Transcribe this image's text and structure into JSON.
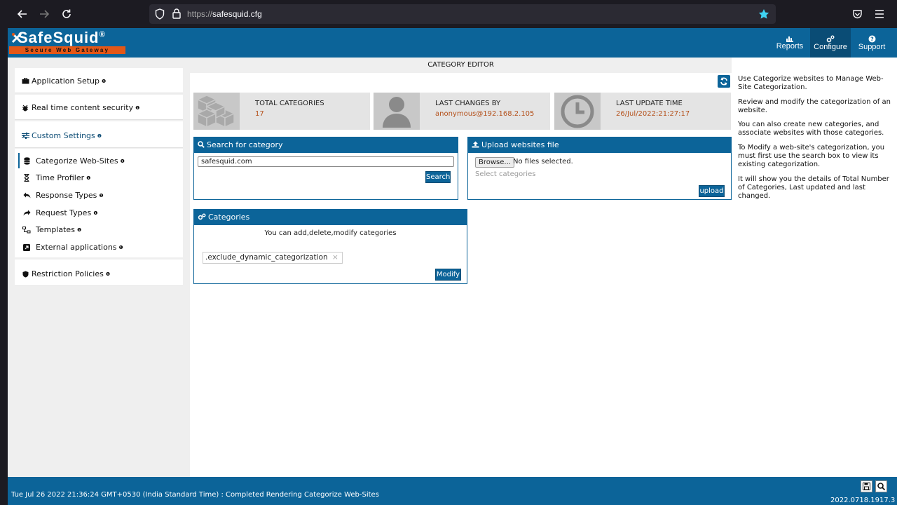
{
  "browser": {
    "url_scheme": "https://",
    "url_host": "safesquid.cfg",
    "icons": [
      "back-arrow-icon",
      "forward-arrow-icon",
      "reload-icon",
      "shield-icon",
      "lock-icon",
      "bookmark-star-icon",
      "pocket-icon",
      "hamburger-menu-icon"
    ]
  },
  "logo": {
    "name": "SafeSquid",
    "reg": "®",
    "tagline": "Secure Web Gateway"
  },
  "topnav": [
    {
      "label": "Reports",
      "icon": "chart-icon"
    },
    {
      "label": "Configure",
      "icon": "cogs-icon",
      "active": true
    },
    {
      "label": "Support",
      "icon": "question-icon"
    }
  ],
  "sidebar": {
    "application_setup": "Application Setup",
    "realtime": "Real time content security",
    "custom_settings": "Custom Settings",
    "items": [
      {
        "label": "Categorize Web-Sites"
      },
      {
        "label": "Time Profiler"
      },
      {
        "label": "Response Types"
      },
      {
        "label": "Request Types"
      },
      {
        "label": "Templates"
      },
      {
        "label": "External applications"
      }
    ],
    "restriction": "Restriction Policies",
    "info_glyph": "❶"
  },
  "main": {
    "title": "CATEGORY EDITOR",
    "stats": [
      {
        "title": "TOTAL CATEGORIES",
        "value": "17"
      },
      {
        "title": "LAST CHANGES BY",
        "value": "anonymous@192.168.2.105"
      },
      {
        "title": "LAST UPDATE TIME",
        "value": "26/Jul/2022:21:27:17"
      }
    ],
    "search": {
      "heading": "Search for category",
      "value": "safesquid.com",
      "button": "Search"
    },
    "upload": {
      "heading": "Upload websites file",
      "browse": "Browse...",
      "no_file": "No files selected.",
      "select_placeholder": "Select categories",
      "button": "upload"
    },
    "categories": {
      "heading": "Categories",
      "subtitle": "You can add,delete,modify categories",
      "tag": ".exclude_dynamic_categorization",
      "tag_remove": "×",
      "button": "Modify"
    }
  },
  "help": {
    "p1": "Use Categorize websites to Manage Web-Site Categorization.",
    "p2": "Review and modify the categorization of an website.",
    "p3": "You can also create new categories, and associate websites with those categories.",
    "p4": "To Modify a web-site's categorization, you must first use the search box to view its existing categorization.",
    "p5": "It will show you the details of Total Number of Categories, Last updated and last changed."
  },
  "status": {
    "message": "Tue Jul 26 2022 21:36:24 GMT+0530 (India Standard Time) : Completed Rendering Categorize Web-Sites",
    "version": "2022.0718.1917.3"
  },
  "colors": {
    "brand": "#0c6499",
    "accent": "#e35717",
    "value_text": "#b4501a"
  }
}
